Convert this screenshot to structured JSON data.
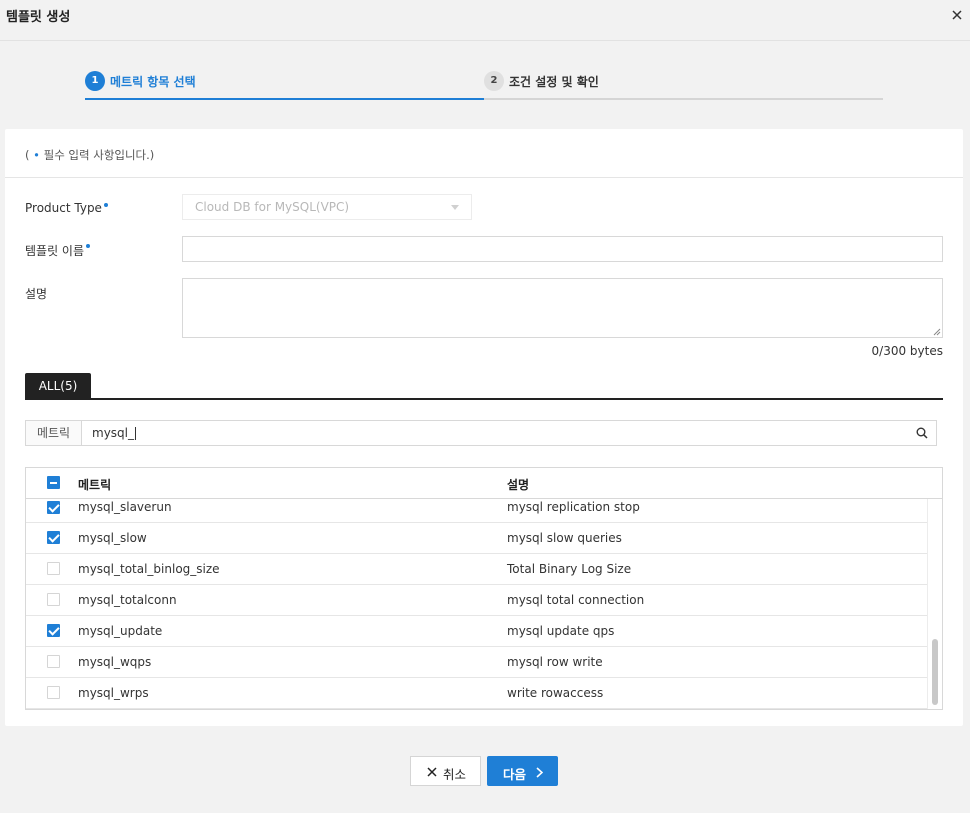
{
  "header": {
    "title": "템플릿 생성",
    "close_icon": "close-icon"
  },
  "steps": [
    {
      "number": "1",
      "label": "메트릭 항목 선택",
      "active": true
    },
    {
      "number": "2",
      "label": "조건 설정 및 확인",
      "active": false
    }
  ],
  "form": {
    "required_note_prefix": "( ",
    "required_note_dot": "•",
    "required_note_text": " 필수 입력 사항입니다.)",
    "product_type_label": "Product Type",
    "product_type_value": "Cloud DB for MySQL(VPC)",
    "template_name_label": "템플릿 이름",
    "template_name_value": "",
    "description_label": "설명",
    "description_value": "",
    "byte_counter": "0/300 bytes"
  },
  "tabs": [
    {
      "label": "ALL(5)",
      "active": true
    }
  ],
  "search": {
    "label": "메트릭",
    "value": "mysql_",
    "icon": "search-icon"
  },
  "table": {
    "header": {
      "col_metric": "메트릭",
      "col_desc": "설명",
      "select_all_state": "partial"
    },
    "rows": [
      {
        "metric": "mysql_slaverun",
        "desc": "mysql replication stop",
        "checked": true
      },
      {
        "metric": "mysql_slow",
        "desc": "mysql slow queries",
        "checked": true
      },
      {
        "metric": "mysql_total_binlog_size",
        "desc": "Total Binary Log Size",
        "checked": false
      },
      {
        "metric": "mysql_totalconn",
        "desc": "mysql total connection",
        "checked": false
      },
      {
        "metric": "mysql_update",
        "desc": "mysql update qps",
        "checked": true
      },
      {
        "metric": "mysql_wqps",
        "desc": "mysql row write",
        "checked": false
      },
      {
        "metric": "mysql_wrps",
        "desc": "write rowaccess",
        "checked": false
      }
    ]
  },
  "buttons": {
    "cancel_label": "취소",
    "next_label": "다음"
  },
  "colors": {
    "accent": "#1f7fd6",
    "dark_tab": "#222222"
  }
}
